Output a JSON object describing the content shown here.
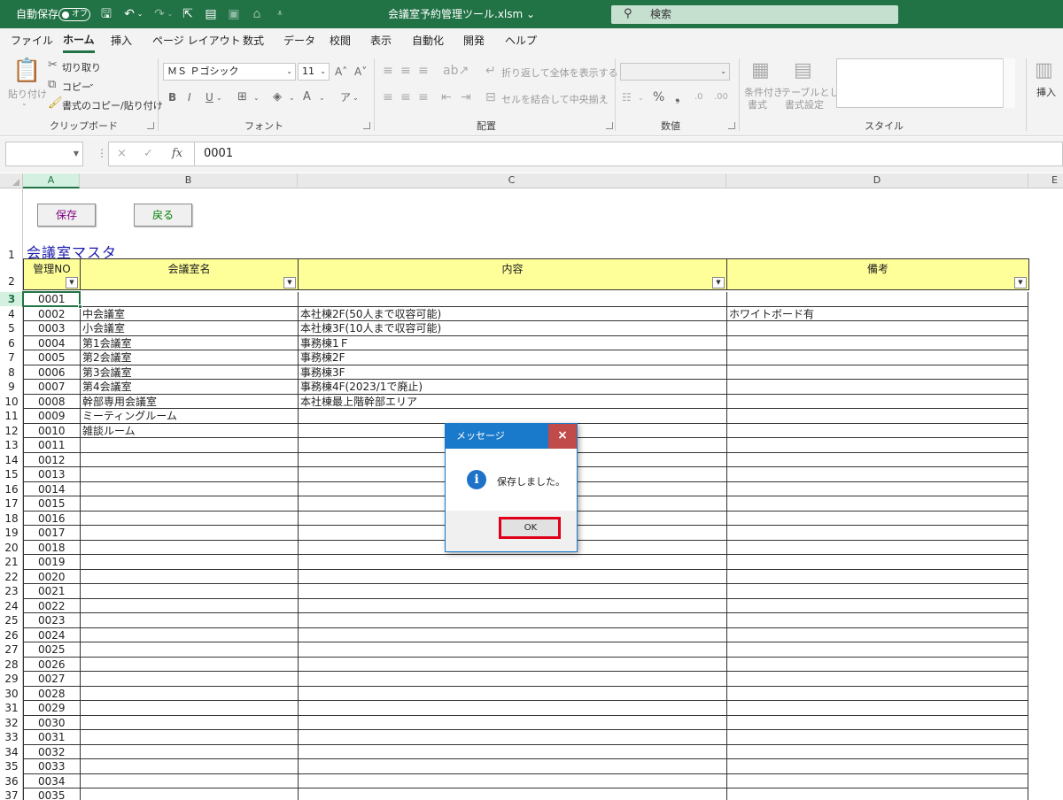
{
  "titlebar": {
    "autosave_label": "自動保存",
    "autosave_state": "オフ",
    "filename": "会議室予約管理ツール.xlsm ⌄",
    "search_placeholder": "検索"
  },
  "tabs": [
    "ファイル",
    "ホーム",
    "挿入",
    "ページ レイアウト",
    "数式",
    "データ",
    "校閲",
    "表示",
    "自動化",
    "開発",
    "ヘルプ"
  ],
  "active_tab": "ホーム",
  "ribbon": {
    "clipboard": {
      "paste": "貼り付け",
      "cut": "切り取り",
      "copy": "コピー",
      "format_painter": "書式のコピー/貼り付け",
      "label": "クリップボード"
    },
    "font": {
      "name": "ＭＳ Ｐゴシック",
      "size": "11",
      "label": "フォント"
    },
    "alignment": {
      "wrap": "折り返して全体を表示する",
      "merge": "セルを結合して中央揃え",
      "label": "配置"
    },
    "number": {
      "label": "数値"
    },
    "styles": {
      "conditional": "条件付き",
      "conditional2": "書式",
      "table": "テーブルとして",
      "table2": "書式設定",
      "label": "スタイル"
    },
    "cells": {
      "insert": "挿入"
    }
  },
  "formula_bar": {
    "cancel": "×",
    "enter": "✓",
    "fx": "fx",
    "value": "0001"
  },
  "columns": [
    "A",
    "B",
    "C",
    "D",
    "E"
  ],
  "active_column": "A",
  "buttons": {
    "save": "保存",
    "back": "戻る"
  },
  "sheet_title": "会議室マスタ",
  "headers": [
    "管理NO",
    "会議室名",
    "内容",
    "備考"
  ],
  "row_numbers": [
    "1",
    "2",
    "3",
    "4",
    "5",
    "6",
    "7",
    "8",
    "9",
    "10",
    "11",
    "12",
    "13",
    "14",
    "15",
    "16",
    "17",
    "18",
    "19",
    "20",
    "21",
    "22",
    "23",
    "24",
    "25",
    "26",
    "27",
    "28",
    "29",
    "30",
    "31",
    "32",
    "33",
    "34",
    "35",
    "36",
    "37"
  ],
  "rows": [
    [
      "0001",
      "",
      "",
      ""
    ],
    [
      "0002",
      "中会議室",
      "本社棟2F(50人まで収容可能)",
      "ホワイトボード有"
    ],
    [
      "0003",
      "小会議室",
      "本社棟3F(10人まで収容可能)",
      ""
    ],
    [
      "0004",
      "第1会議室",
      "事務棟1Ｆ",
      ""
    ],
    [
      "0005",
      "第2会議室",
      "事務棟2F",
      ""
    ],
    [
      "0006",
      "第3会議室",
      "事務棟3F",
      ""
    ],
    [
      "0007",
      "第4会議室",
      "事務棟4F(2023/1で廃止)",
      ""
    ],
    [
      "0008",
      "幹部専用会議室",
      "本社棟最上階幹部エリア",
      ""
    ],
    [
      "0009",
      "ミーティングルーム",
      "",
      ""
    ],
    [
      "0010",
      "雑談ルーム",
      "",
      ""
    ],
    [
      "0011",
      "",
      "",
      ""
    ],
    [
      "0012",
      "",
      "",
      ""
    ],
    [
      "0013",
      "",
      "",
      ""
    ],
    [
      "0014",
      "",
      "",
      ""
    ],
    [
      "0015",
      "",
      "",
      ""
    ],
    [
      "0016",
      "",
      "",
      ""
    ],
    [
      "0017",
      "",
      "",
      ""
    ],
    [
      "0018",
      "",
      "",
      ""
    ],
    [
      "0019",
      "",
      "",
      ""
    ],
    [
      "0020",
      "",
      "",
      ""
    ],
    [
      "0021",
      "",
      "",
      ""
    ],
    [
      "0022",
      "",
      "",
      ""
    ],
    [
      "0023",
      "",
      "",
      ""
    ],
    [
      "0024",
      "",
      "",
      ""
    ],
    [
      "0025",
      "",
      "",
      ""
    ],
    [
      "0026",
      "",
      "",
      ""
    ],
    [
      "0027",
      "",
      "",
      ""
    ],
    [
      "0028",
      "",
      "",
      ""
    ],
    [
      "0029",
      "",
      "",
      ""
    ],
    [
      "0030",
      "",
      "",
      ""
    ],
    [
      "0031",
      "",
      "",
      ""
    ],
    [
      "0032",
      "",
      "",
      ""
    ],
    [
      "0033",
      "",
      "",
      ""
    ],
    [
      "0034",
      "",
      "",
      ""
    ],
    [
      "0035",
      "",
      "",
      ""
    ]
  ],
  "dialog": {
    "title": "メッセージ",
    "close": "×",
    "icon": "i",
    "message": "保存しました。",
    "ok": "OK"
  },
  "colors": {
    "excel_green": "#217346",
    "header_fill": "#ffff99",
    "title_blue": "#1a1aaa",
    "save_text": "#800080",
    "back_text": "#008000",
    "dialog_blue": "#1979ca",
    "highlight_red": "#e0001a"
  }
}
